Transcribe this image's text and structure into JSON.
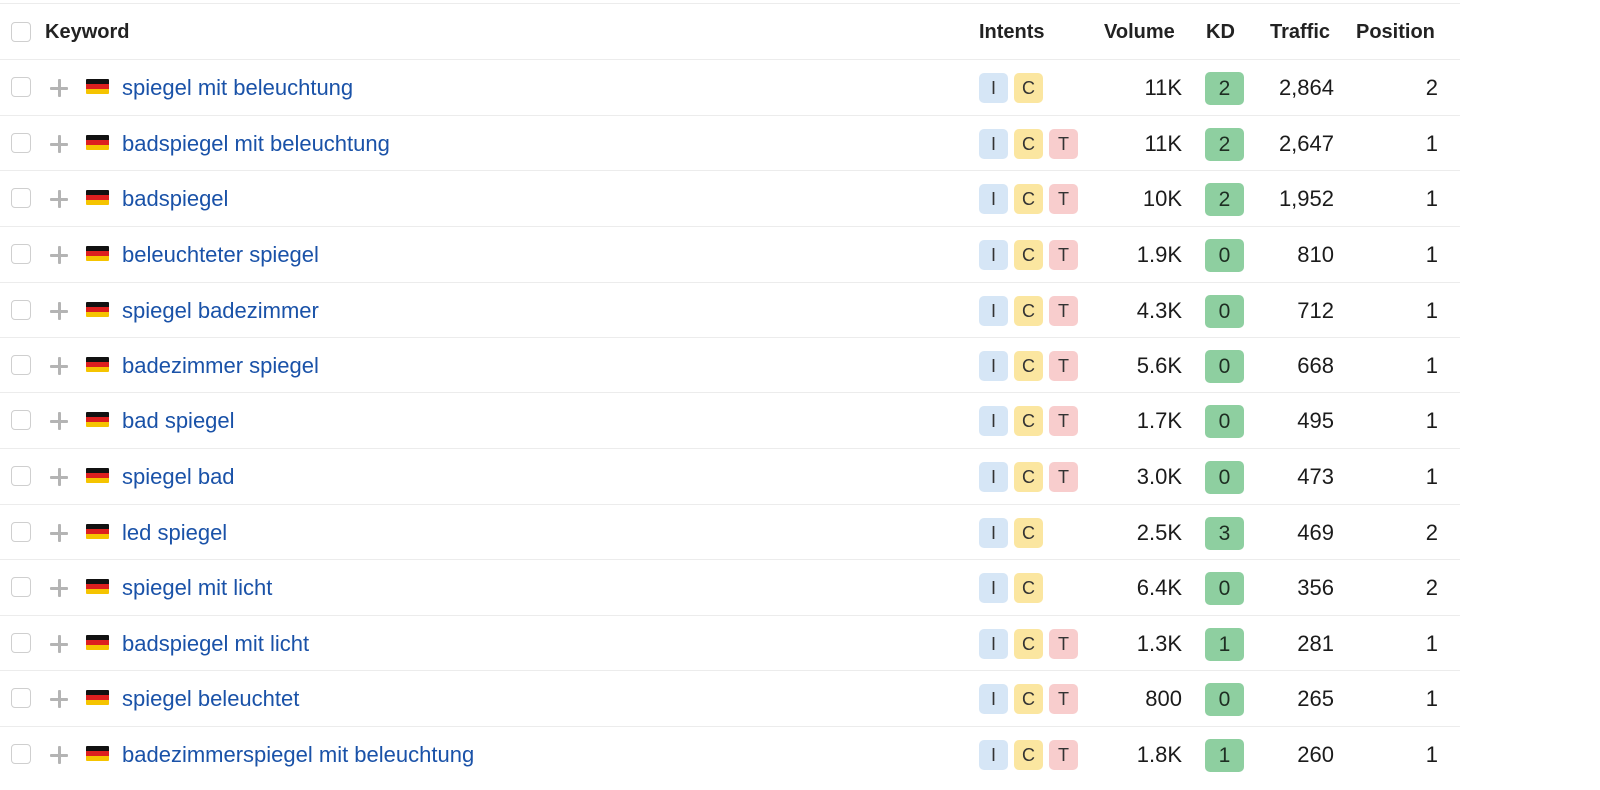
{
  "table": {
    "headers": {
      "keyword": "Keyword",
      "intents": "Intents",
      "volume": "Volume",
      "kd": "KD",
      "traffic": "Traffic",
      "position": "Position"
    },
    "rows": [
      {
        "keyword": "spiegel mit beleuchtung",
        "intents": [
          "I",
          "C"
        ],
        "volume": "11K",
        "kd": "2",
        "traffic": "2,864",
        "position": "2"
      },
      {
        "keyword": "badspiegel mit beleuchtung",
        "intents": [
          "I",
          "C",
          "T"
        ],
        "volume": "11K",
        "kd": "2",
        "traffic": "2,647",
        "position": "1"
      },
      {
        "keyword": "badspiegel",
        "intents": [
          "I",
          "C",
          "T"
        ],
        "volume": "10K",
        "kd": "2",
        "traffic": "1,952",
        "position": "1"
      },
      {
        "keyword": "beleuchteter spiegel",
        "intents": [
          "I",
          "C",
          "T"
        ],
        "volume": "1.9K",
        "kd": "0",
        "traffic": "810",
        "position": "1"
      },
      {
        "keyword": "spiegel badezimmer",
        "intents": [
          "I",
          "C",
          "T"
        ],
        "volume": "4.3K",
        "kd": "0",
        "traffic": "712",
        "position": "1"
      },
      {
        "keyword": "badezimmer spiegel",
        "intents": [
          "I",
          "C",
          "T"
        ],
        "volume": "5.6K",
        "kd": "0",
        "traffic": "668",
        "position": "1"
      },
      {
        "keyword": "bad spiegel",
        "intents": [
          "I",
          "C",
          "T"
        ],
        "volume": "1.7K",
        "kd": "0",
        "traffic": "495",
        "position": "1"
      },
      {
        "keyword": "spiegel bad",
        "intents": [
          "I",
          "C",
          "T"
        ],
        "volume": "3.0K",
        "kd": "0",
        "traffic": "473",
        "position": "1"
      },
      {
        "keyword": "led spiegel",
        "intents": [
          "I",
          "C"
        ],
        "volume": "2.5K",
        "kd": "3",
        "traffic": "469",
        "position": "2"
      },
      {
        "keyword": "spiegel mit licht",
        "intents": [
          "I",
          "C"
        ],
        "volume": "6.4K",
        "kd": "0",
        "traffic": "356",
        "position": "2"
      },
      {
        "keyword": "badspiegel mit licht",
        "intents": [
          "I",
          "C",
          "T"
        ],
        "volume": "1.3K",
        "kd": "1",
        "traffic": "281",
        "position": "1"
      },
      {
        "keyword": "spiegel beleuchtet",
        "intents": [
          "I",
          "C",
          "T"
        ],
        "volume": "800",
        "kd": "0",
        "traffic": "265",
        "position": "1"
      },
      {
        "keyword": "badezimmerspiegel mit beleuchtung",
        "intents": [
          "I",
          "C",
          "T"
        ],
        "volume": "1.8K",
        "kd": "1",
        "traffic": "260",
        "position": "1"
      }
    ]
  },
  "colors": {
    "keyword_link": "#1a52a8",
    "kd_badge": "#8ecfa0",
    "intent_informational": "#d6e6f6",
    "intent_commercial": "#fbe6a0",
    "intent_transactional": "#f8cdcd"
  },
  "icons": {
    "row_add": "plus-icon",
    "country": "germany-flag-icon"
  }
}
